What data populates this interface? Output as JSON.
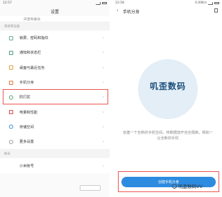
{
  "left": {
    "status": {
      "time": "12:57"
    },
    "title": "设置",
    "top_item": "声音和振动",
    "section_label": "系统和设备",
    "items": [
      {
        "label": "锁屏、密码和指纹",
        "icon": "lock-icon"
      },
      {
        "label": "通知和状态栏",
        "icon": "bell-icon"
      },
      {
        "label": "桌面与最近任务",
        "icon": "desktop-icon"
      },
      {
        "label": "手机分身",
        "icon": "dual-phone-icon"
      },
      {
        "label": "防打扰",
        "icon": "shield-icon"
      },
      {
        "label": "电量和性能",
        "icon": "battery-icon"
      },
      {
        "label": "存储空间",
        "icon": "storage-icon"
      },
      {
        "label": "更多设置",
        "icon": "more-icon"
      }
    ],
    "section2_label": "帐号",
    "account_item": "小米帐号"
  },
  "right": {
    "status": {
      "time": "12:58",
      "net": "0.00K/s"
    },
    "title": "手机分身",
    "logo_text": "叽歪数码",
    "description": "创建一个全新的手机空间，将数据放开完全隔离，相如一台全新的手机",
    "button": "创建手机分身",
    "watermark": "叽歪数码VV"
  },
  "colors": {
    "accent": "#2d8be0",
    "highlight": "#e8544f"
  }
}
